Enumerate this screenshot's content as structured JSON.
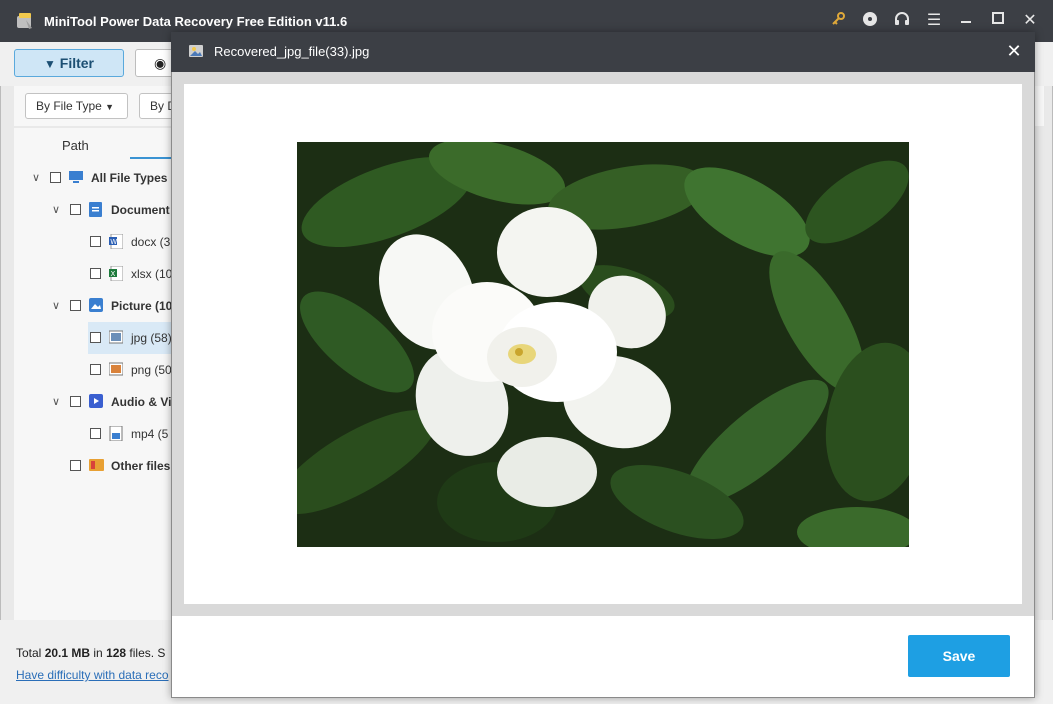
{
  "window": {
    "title": "MiniTool Power Data Recovery Free Edition v11.6",
    "title_icons": [
      "key-icon",
      "disc-icon",
      "headphones-icon",
      "menu-icon",
      "minimize-icon",
      "maximize-icon",
      "close-icon"
    ]
  },
  "toolbar": {
    "filter_label": "Filter",
    "preview_label": "Preview"
  },
  "filters": {
    "by_file_type": "By File Type",
    "by_d_partial": "By D"
  },
  "tabs": {
    "path_label": "Path"
  },
  "tree": [
    {
      "label": "All File Types (",
      "level": 0,
      "expanded": true,
      "icon": "computer-icon",
      "bold": true
    },
    {
      "label": "Document",
      "level": 1,
      "expanded": true,
      "icon": "document-icon",
      "bold": true
    },
    {
      "label": "docx (3",
      "level": 2,
      "icon": "word-icon",
      "bold": false
    },
    {
      "label": "xlsx (10",
      "level": 2,
      "icon": "excel-icon",
      "bold": false
    },
    {
      "label": "Picture (10",
      "level": 1,
      "expanded": true,
      "icon": "picture-icon",
      "bold": true
    },
    {
      "label": "jpg (58)",
      "level": 2,
      "icon": "jpg-icon",
      "bold": false,
      "selected": true
    },
    {
      "label": "png (50",
      "level": 2,
      "icon": "png-icon",
      "bold": false
    },
    {
      "label": "Audio & Vi",
      "level": 1,
      "expanded": true,
      "icon": "audio-video-icon",
      "bold": true
    },
    {
      "label": "mp4 (5",
      "level": 2,
      "icon": "mp4-icon",
      "bold": false
    },
    {
      "label": "Other files",
      "level": 1,
      "icon": "other-files-icon",
      "bold": true
    }
  ],
  "status": {
    "prefix": "Total ",
    "size": "20.1 MB",
    "middle": " in ",
    "count": "128",
    "suffix": " files.  S",
    "help_link": "Have difficulty with data reco"
  },
  "dialog": {
    "title": "Recovered_jpg_file(33).jpg",
    "save_label": "Save"
  },
  "colors": {
    "titlebar": "#3c3f45",
    "accent": "#1e9fe3",
    "link": "#2a6eb8"
  }
}
